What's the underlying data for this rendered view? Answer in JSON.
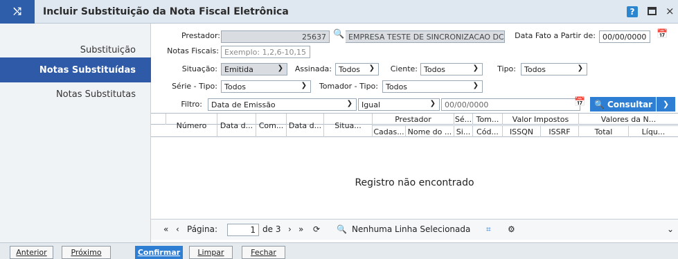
{
  "window": {
    "title": "Incluir Substituição da Nota Fiscal Eletrônica",
    "help": "?",
    "close": "×"
  },
  "sidebar": {
    "items": [
      {
        "label": "Substituição"
      },
      {
        "label": "Notas Substituídas"
      },
      {
        "label": "Notas Substitutas"
      }
    ]
  },
  "form": {
    "prestador_label": "Prestador:",
    "prestador_code": "25637",
    "prestador_name": "EMPRESA TESTE DE SINCRONIZACAO DC - CO",
    "data_fato_label": "Data Fato a Partir de:",
    "data_fato_value": "00/00/0000",
    "notas_label": "Notas Fiscais:",
    "notas_placeholder": "Exemplo: 1,2,6-10,15",
    "situacao_label": "Situação:",
    "situacao_value": "Emitida",
    "assinada_label": "Assinada:",
    "assinada_value": "Todos",
    "ciente_label": "Ciente:",
    "ciente_value": "Todos",
    "tipo_label": "Tipo:",
    "tipo_value": "Todos",
    "serie_label": "Série - Tipo:",
    "serie_value": "Todos",
    "tomador_label": "Tomador - Tipo:",
    "tomador_value": "Todos",
    "filtro_label": "Filtro:",
    "filtro_field": "Data de Emissão",
    "filtro_op": "Igual",
    "filtro_value": "00/00/0000",
    "consultar_label": "Consultar"
  },
  "grid": {
    "headers_top": {
      "prestador": "Prestador",
      "se": "Sé...",
      "tom": "Tom...",
      "valor_impostos": "Valor Impostos",
      "valores": "Valores da N..."
    },
    "headers": {
      "numero": "Número",
      "data1": "Data d...",
      "com": "Com...",
      "data2": "Data d...",
      "situa": "Situa...",
      "cadas": "Cadas...",
      "nome": "Nome do ...",
      "si": "Si...",
      "cod": "Cód...",
      "issqn": "ISSQN",
      "issrf": "ISSRF",
      "total": "Total",
      "liqu": "Líqu..."
    },
    "empty_message": "Registro não encontrado"
  },
  "pager": {
    "label": "Página:",
    "page": "1",
    "of": "de 3",
    "status": "Nenhuma Linha Selecionada"
  },
  "buttons": {
    "anterior": "Anterior",
    "proximo": "Próximo",
    "confirmar": "Confirmar",
    "limpar": "Limpar",
    "fechar": "Fechar"
  }
}
